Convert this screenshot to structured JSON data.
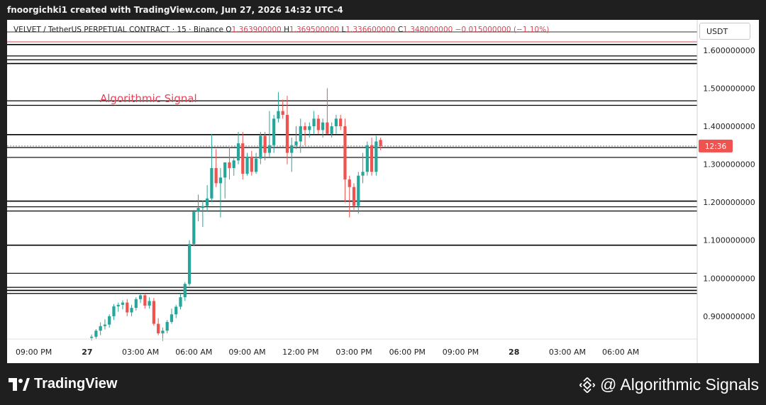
{
  "topbar": {
    "text": "fnoorgichki1 created with TradingView.com, Jun 27, 2026 14:32 UTC-4"
  },
  "header": {
    "symbol": "VELVET / TetherUS PERPETUAL CONTRACT · 15 · Binance",
    "o_label": "O",
    "o_value": "1.363900000",
    "h_label": "H",
    "h_value": "1.369500000",
    "l_label": "L",
    "l_value": "1.336600000",
    "c_label": "C",
    "c_value": "1.348000000",
    "change": "−0.015000000 (−1.10%)"
  },
  "currency": "USDT",
  "annotation": "Algorithmic Signal",
  "last_time_badge": "12:36",
  "footer": {
    "brand": "TradingView",
    "watermark": "@ Algorithmic Signals"
  },
  "colors": {
    "up": "#26a69a",
    "down": "#ef5350",
    "annotation": "#e0465a",
    "badge": "#ef5350",
    "background": "#ffffff"
  },
  "icons": {
    "brand": "tradingview-logo-icon",
    "watermark": "binance-icon"
  },
  "chart_data": {
    "type": "candlestick",
    "title": "",
    "ylim": [
      0.84,
      1.68
    ],
    "y_ticks": [
      "1.600000000",
      "1.500000000",
      "1.400000000",
      "1.300000000",
      "1.200000000",
      "1.100000000",
      "1.000000000",
      "0.900000000"
    ],
    "y_tick_values": [
      1.6,
      1.5,
      1.4,
      1.3,
      1.2,
      1.1,
      1.0,
      0.9
    ],
    "x_ticks": [
      "09:00 PM",
      "27",
      "03:00 AM",
      "06:00 AM",
      "09:00 AM",
      "12:00 PM",
      "03:00 PM",
      "06:00 PM",
      "09:00 PM",
      "28",
      "03:00 AM",
      "06:00 AM"
    ],
    "x_tick_hours": [
      -3,
      0,
      3,
      6,
      9,
      12,
      15,
      18,
      21,
      24,
      27,
      30
    ],
    "x_range_hours": [
      -4.5,
      34.3
    ],
    "horizontal_levels": [
      1.615,
      1.585,
      1.575,
      1.565,
      1.467,
      1.455,
      1.378,
      1.344,
      1.318,
      1.203,
      1.188,
      1.177,
      1.087,
      1.013,
      0.976,
      0.968,
      0.96
    ],
    "current_price": 1.348,
    "candles": [
      {
        "t": 0.25,
        "o": 0.843,
        "h": 0.852,
        "l": 0.836,
        "c": 0.846
      },
      {
        "t": 0.5,
        "o": 0.846,
        "h": 0.866,
        "l": 0.84,
        "c": 0.862
      },
      {
        "t": 0.75,
        "o": 0.862,
        "h": 0.884,
        "l": 0.85,
        "c": 0.874
      },
      {
        "t": 1.0,
        "o": 0.874,
        "h": 0.892,
        "l": 0.865,
        "c": 0.878
      },
      {
        "t": 1.25,
        "o": 0.878,
        "h": 0.905,
        "l": 0.87,
        "c": 0.9
      },
      {
        "t": 1.5,
        "o": 0.9,
        "h": 0.932,
        "l": 0.89,
        "c": 0.926
      },
      {
        "t": 1.75,
        "o": 0.926,
        "h": 0.936,
        "l": 0.912,
        "c": 0.93
      },
      {
        "t": 2.0,
        "o": 0.93,
        "h": 0.942,
        "l": 0.918,
        "c": 0.936
      },
      {
        "t": 2.25,
        "o": 0.936,
        "h": 0.945,
        "l": 0.9,
        "c": 0.91
      },
      {
        "t": 2.5,
        "o": 0.91,
        "h": 0.93,
        "l": 0.9,
        "c": 0.922
      },
      {
        "t": 2.75,
        "o": 0.922,
        "h": 0.95,
        "l": 0.915,
        "c": 0.945
      },
      {
        "t": 3.0,
        "o": 0.945,
        "h": 0.96,
        "l": 0.935,
        "c": 0.955
      },
      {
        "t": 3.25,
        "o": 0.955,
        "h": 0.96,
        "l": 0.92,
        "c": 0.928
      },
      {
        "t": 3.5,
        "o": 0.928,
        "h": 0.95,
        "l": 0.92,
        "c": 0.94
      },
      {
        "t": 3.75,
        "o": 0.94,
        "h": 0.948,
        "l": 0.875,
        "c": 0.88
      },
      {
        "t": 4.0,
        "o": 0.88,
        "h": 0.895,
        "l": 0.85,
        "c": 0.855
      },
      {
        "t": 4.25,
        "o": 0.855,
        "h": 0.87,
        "l": 0.835,
        "c": 0.862
      },
      {
        "t": 4.5,
        "o": 0.862,
        "h": 0.89,
        "l": 0.855,
        "c": 0.885
      },
      {
        "t": 4.75,
        "o": 0.885,
        "h": 0.92,
        "l": 0.88,
        "c": 0.905
      },
      {
        "t": 5.0,
        "o": 0.905,
        "h": 0.93,
        "l": 0.895,
        "c": 0.925
      },
      {
        "t": 5.25,
        "o": 0.925,
        "h": 0.96,
        "l": 0.918,
        "c": 0.95
      },
      {
        "t": 5.5,
        "o": 0.95,
        "h": 0.99,
        "l": 0.94,
        "c": 0.985
      },
      {
        "t": 5.75,
        "o": 0.985,
        "h": 1.1,
        "l": 0.98,
        "c": 1.09
      },
      {
        "t": 6.0,
        "o": 1.09,
        "h": 1.18,
        "l": 1.085,
        "c": 1.175
      },
      {
        "t": 6.25,
        "o": 1.175,
        "h": 1.22,
        "l": 1.15,
        "c": 1.185
      },
      {
        "t": 6.5,
        "o": 1.185,
        "h": 1.205,
        "l": 1.135,
        "c": 1.19
      },
      {
        "t": 6.75,
        "o": 1.19,
        "h": 1.245,
        "l": 1.175,
        "c": 1.21
      },
      {
        "t": 7.0,
        "o": 1.21,
        "h": 1.38,
        "l": 1.2,
        "c": 1.29
      },
      {
        "t": 7.25,
        "o": 1.29,
        "h": 1.34,
        "l": 1.24,
        "c": 1.25
      },
      {
        "t": 7.5,
        "o": 1.25,
        "h": 1.29,
        "l": 1.16,
        "c": 1.265
      },
      {
        "t": 7.75,
        "o": 1.265,
        "h": 1.3,
        "l": 1.21,
        "c": 1.305
      },
      {
        "t": 8.0,
        "o": 1.305,
        "h": 1.345,
        "l": 1.26,
        "c": 1.29
      },
      {
        "t": 8.25,
        "o": 1.29,
        "h": 1.32,
        "l": 1.27,
        "c": 1.31
      },
      {
        "t": 8.5,
        "o": 1.31,
        "h": 1.385,
        "l": 1.3,
        "c": 1.355
      },
      {
        "t": 8.75,
        "o": 1.355,
        "h": 1.385,
        "l": 1.26,
        "c": 1.275
      },
      {
        "t": 9.0,
        "o": 1.275,
        "h": 1.33,
        "l": 1.27,
        "c": 1.32
      },
      {
        "t": 9.25,
        "o": 1.32,
        "h": 1.335,
        "l": 1.27,
        "c": 1.28
      },
      {
        "t": 9.5,
        "o": 1.28,
        "h": 1.33,
        "l": 1.275,
        "c": 1.315
      },
      {
        "t": 9.75,
        "o": 1.315,
        "h": 1.385,
        "l": 1.3,
        "c": 1.375
      },
      {
        "t": 10.0,
        "o": 1.375,
        "h": 1.385,
        "l": 1.31,
        "c": 1.33
      },
      {
        "t": 10.25,
        "o": 1.33,
        "h": 1.44,
        "l": 1.32,
        "c": 1.35
      },
      {
        "t": 10.5,
        "o": 1.35,
        "h": 1.43,
        "l": 1.33,
        "c": 1.42
      },
      {
        "t": 10.75,
        "o": 1.42,
        "h": 1.49,
        "l": 1.41,
        "c": 1.44
      },
      {
        "t": 11.0,
        "o": 1.44,
        "h": 1.47,
        "l": 1.42,
        "c": 1.43
      },
      {
        "t": 11.25,
        "o": 1.43,
        "h": 1.48,
        "l": 1.3,
        "c": 1.33
      },
      {
        "t": 11.5,
        "o": 1.33,
        "h": 1.37,
        "l": 1.28,
        "c": 1.35
      },
      {
        "t": 11.75,
        "o": 1.35,
        "h": 1.4,
        "l": 1.34,
        "c": 1.36
      },
      {
        "t": 12.0,
        "o": 1.36,
        "h": 1.42,
        "l": 1.33,
        "c": 1.4
      },
      {
        "t": 12.25,
        "o": 1.4,
        "h": 1.41,
        "l": 1.35,
        "c": 1.39
      },
      {
        "t": 12.5,
        "o": 1.39,
        "h": 1.41,
        "l": 1.37,
        "c": 1.4
      },
      {
        "t": 12.75,
        "o": 1.4,
        "h": 1.44,
        "l": 1.38,
        "c": 1.42
      },
      {
        "t": 13.0,
        "o": 1.42,
        "h": 1.43,
        "l": 1.38,
        "c": 1.39
      },
      {
        "t": 13.25,
        "o": 1.39,
        "h": 1.42,
        "l": 1.37,
        "c": 1.41
      },
      {
        "t": 13.5,
        "o": 1.41,
        "h": 1.5,
        "l": 1.39,
        "c": 1.38
      },
      {
        "t": 13.75,
        "o": 1.38,
        "h": 1.41,
        "l": 1.37,
        "c": 1.4
      },
      {
        "t": 14.0,
        "o": 1.4,
        "h": 1.43,
        "l": 1.38,
        "c": 1.42
      },
      {
        "t": 14.25,
        "o": 1.42,
        "h": 1.43,
        "l": 1.39,
        "c": 1.4
      },
      {
        "t": 14.5,
        "o": 1.4,
        "h": 1.42,
        "l": 1.2,
        "c": 1.26
      },
      {
        "t": 14.75,
        "o": 1.26,
        "h": 1.27,
        "l": 1.16,
        "c": 1.24
      },
      {
        "t": 15.0,
        "o": 1.24,
        "h": 1.25,
        "l": 1.18,
        "c": 1.19
      },
      {
        "t": 15.25,
        "o": 1.19,
        "h": 1.28,
        "l": 1.17,
        "c": 1.27
      },
      {
        "t": 15.5,
        "o": 1.27,
        "h": 1.33,
        "l": 1.25,
        "c": 1.28
      },
      {
        "t": 15.75,
        "o": 1.28,
        "h": 1.36,
        "l": 1.27,
        "c": 1.35
      },
      {
        "t": 16.0,
        "o": 1.35,
        "h": 1.37,
        "l": 1.27,
        "c": 1.28
      },
      {
        "t": 16.25,
        "o": 1.28,
        "h": 1.375,
        "l": 1.27,
        "c": 1.36
      },
      {
        "t": 16.5,
        "o": 1.364,
        "h": 1.37,
        "l": 1.337,
        "c": 1.348
      }
    ]
  }
}
